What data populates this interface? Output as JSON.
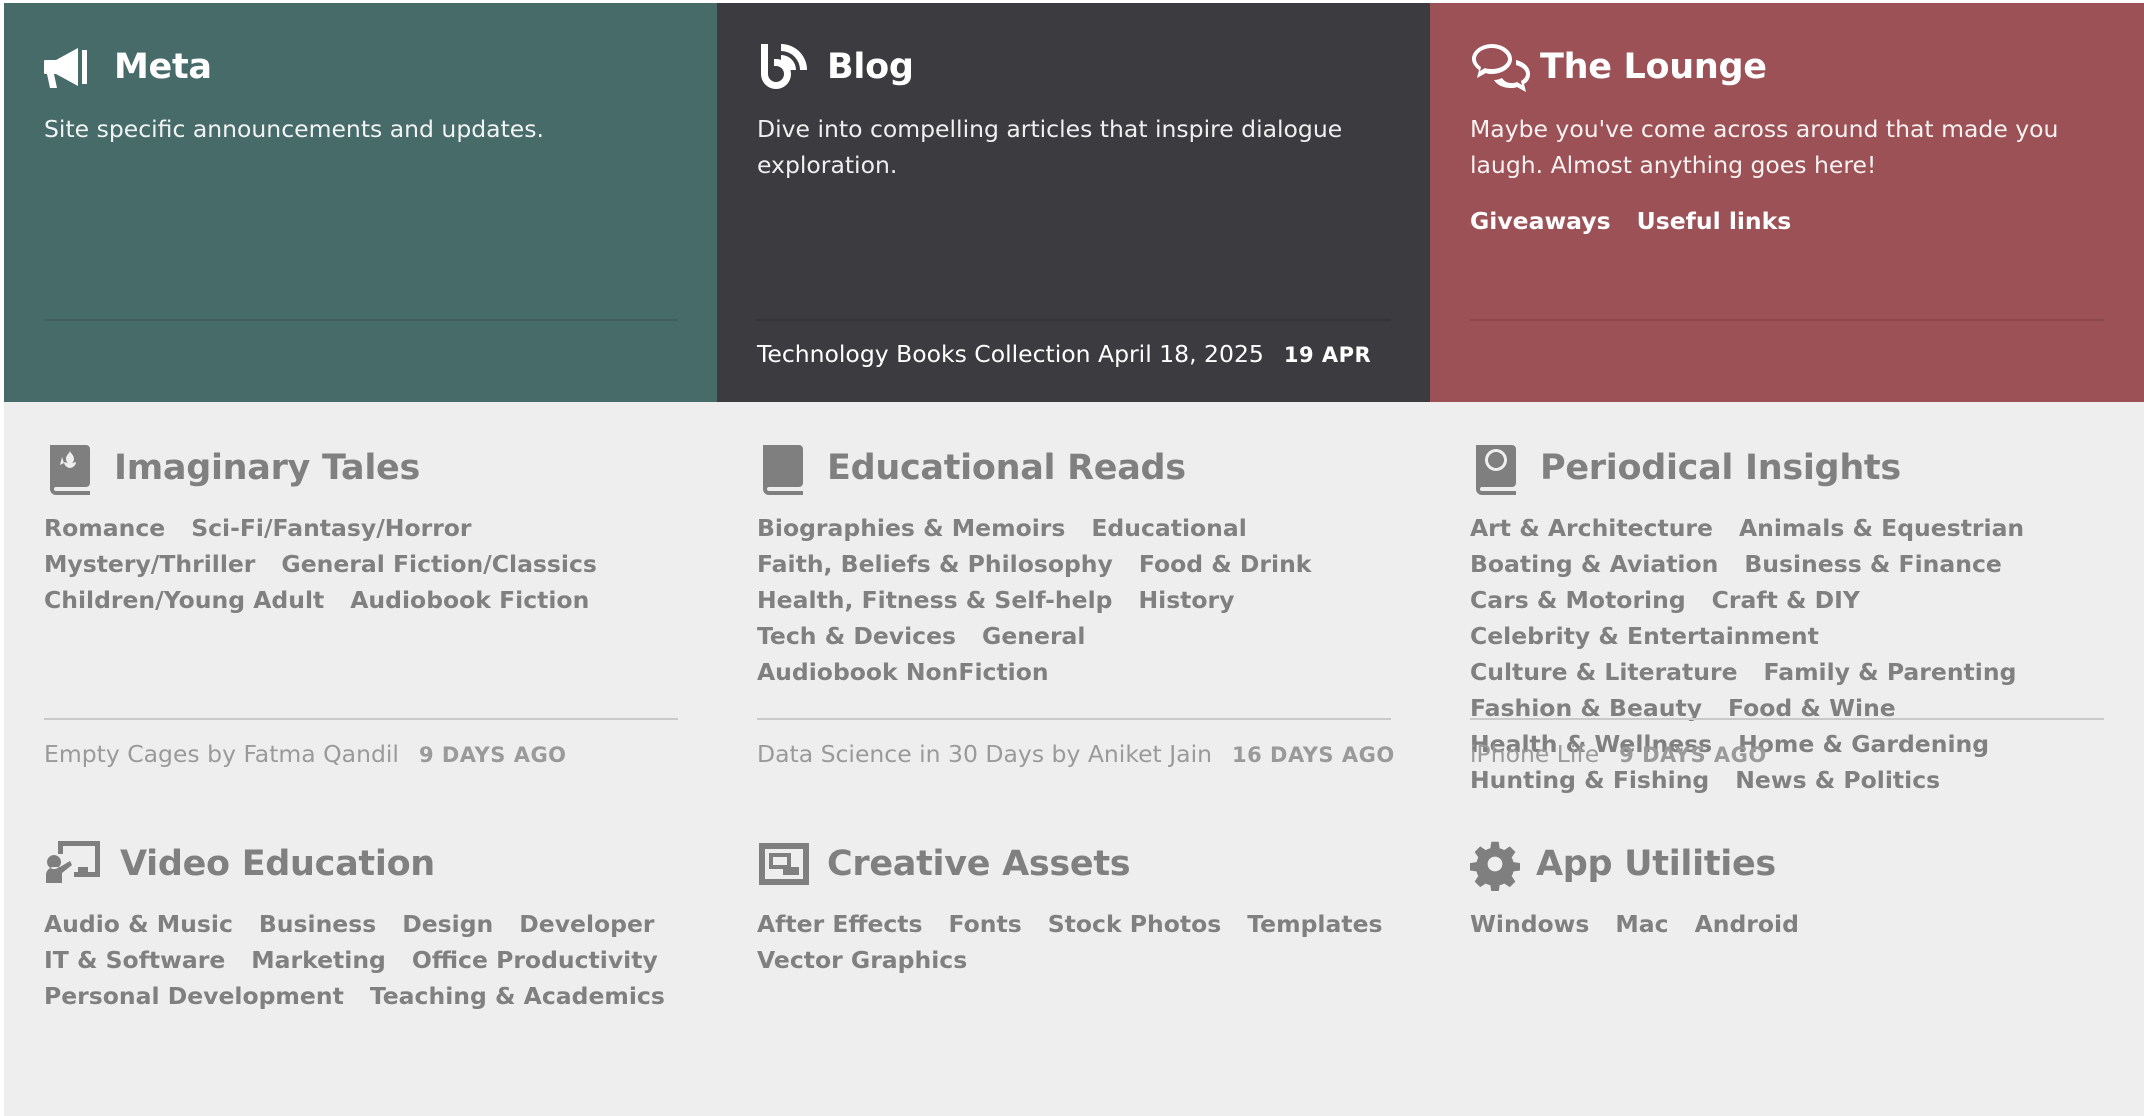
{
  "colors": {
    "meta_bg": "#476b69",
    "blog_bg": "#3c3b3f",
    "lounge_bg": "#9b5155",
    "light_bg": "#eeeeee",
    "muted_text": "#808080"
  },
  "top": [
    {
      "icon": "megaphone-icon",
      "title": "Meta",
      "description": "Site specific announcements and updates.",
      "subcategories": [],
      "latest": {
        "title": "",
        "when": ""
      }
    },
    {
      "icon": "blog-rss-icon",
      "title": "Blog",
      "description": "Dive into compelling articles that inspire dialogue exploration.",
      "subcategories": [],
      "latest": {
        "title": "Technology Books Collection April 18, 2025",
        "when": "19 APR"
      }
    },
    {
      "icon": "chat-bubbles-icon",
      "title": "The Lounge",
      "description": "Maybe you've come across around that made you laugh. Almost anything goes here!",
      "subcategories": [
        "Giveaways",
        "Useful links"
      ],
      "latest": {
        "title": "",
        "when": ""
      }
    }
  ],
  "middle": [
    {
      "icon": "fantasy-book-icon",
      "title": "Imaginary Tales",
      "subcategories": [
        "Romance",
        "Sci-Fi/Fantasy/Horror",
        "Mystery/Thriller",
        "General Fiction/Classics",
        "Children/Young Adult",
        "Audiobook Fiction"
      ],
      "latest": {
        "title": "Empty Cages by Fatma Qandil",
        "when": "9 DAYS AGO"
      }
    },
    {
      "icon": "book-icon",
      "title": "Educational Reads",
      "subcategories": [
        "Biographies & Memoirs",
        "Educational",
        "Faith, Beliefs & Philosophy",
        "Food & Drink",
        "Health, Fitness & Self-help",
        "History",
        "Tech & Devices",
        "General",
        "Audiobook NonFiction"
      ],
      "latest": {
        "title": "Data Science in 30 Days by Aniket Jain",
        "when": "16 DAYS AGO"
      }
    },
    {
      "icon": "globe-book-icon",
      "title": "Periodical Insights",
      "subcategories": [
        "Art & Architecture",
        "Animals & Equestrian",
        "Boating & Aviation",
        "Business & Finance",
        "Cars & Motoring",
        "Craft & DIY",
        "Celebrity & Entertainment",
        "Culture & Literature",
        "Family & Parenting",
        "Fashion & Beauty",
        "Food & Wine",
        "Health & Wellness",
        "Home & Gardening",
        "Hunting & Fishing",
        "News & Politics"
      ],
      "latest": {
        "title": "iPhone Life",
        "when": "9 DAYS AGO"
      }
    }
  ],
  "bottom": [
    {
      "icon": "chalkboard-teacher-icon",
      "title": "Video Education",
      "subcategories": [
        "Audio & Music",
        "Business",
        "Design",
        "Developer",
        "IT & Software",
        "Marketing",
        "Office Productivity",
        "Personal Development",
        "Teaching & Academics"
      ]
    },
    {
      "icon": "photo-film-icon",
      "title": "Creative Assets",
      "subcategories": [
        "After Effects",
        "Fonts",
        "Stock Photos",
        "Templates",
        "Vector Graphics"
      ]
    },
    {
      "icon": "gear-icon",
      "title": "App Utilities",
      "subcategories": [
        "Windows",
        "Mac",
        "Android"
      ]
    }
  ]
}
